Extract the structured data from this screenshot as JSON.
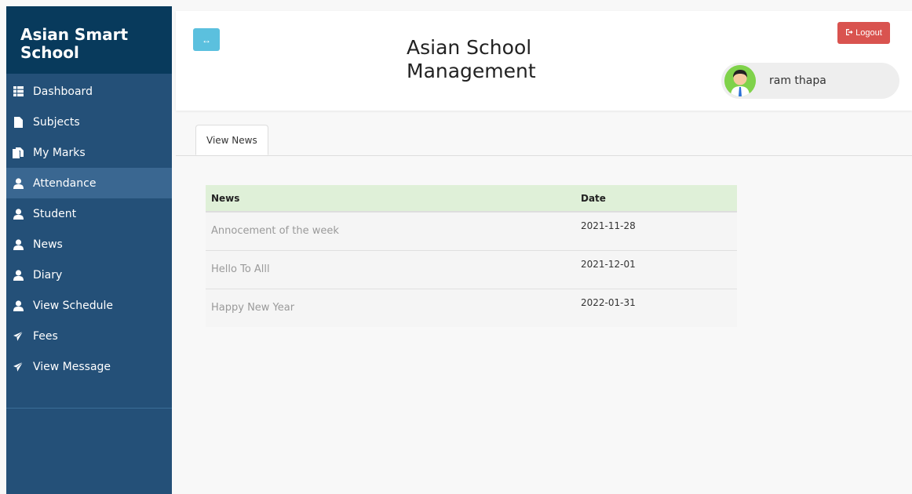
{
  "brand": {
    "title": "Asian Smart School"
  },
  "sidebar": {
    "items": [
      {
        "label": "Dashboard",
        "icon": "th-list-icon"
      },
      {
        "label": "Subjects",
        "icon": "file-icon"
      },
      {
        "label": "My Marks",
        "icon": "files-icon"
      },
      {
        "label": "Attendance",
        "icon": "user-icon",
        "active": true
      },
      {
        "label": "Student",
        "icon": "user-icon"
      },
      {
        "label": "News",
        "icon": "user-icon"
      },
      {
        "label": "Diary",
        "icon": "user-icon"
      },
      {
        "label": "View Schedule",
        "icon": "user-icon"
      },
      {
        "label": "Fees",
        "icon": "send-icon"
      },
      {
        "label": "View Message",
        "icon": "send-icon"
      }
    ]
  },
  "header": {
    "toggle_symbol": "↔",
    "title": "Asian School Management",
    "logout_label": "Logout",
    "user_name": "ram thapa"
  },
  "tabs": [
    {
      "label": "View News"
    }
  ],
  "news_table": {
    "headers": [
      "News",
      "Date"
    ],
    "rows": [
      {
        "news": "Annocement of the week",
        "date": "2021-11-28"
      },
      {
        "news": "Hello To Alll",
        "date": "2021-12-01"
      },
      {
        "news": "Happy New Year",
        "date": "2022-01-31"
      }
    ]
  },
  "colors": {
    "sidebar": "#245078",
    "brand": "#083a5c",
    "active_item": "#3a6791",
    "toggle_button": "#5bc0de",
    "logout_button": "#d9534f",
    "table_header": "#dff0d8"
  }
}
